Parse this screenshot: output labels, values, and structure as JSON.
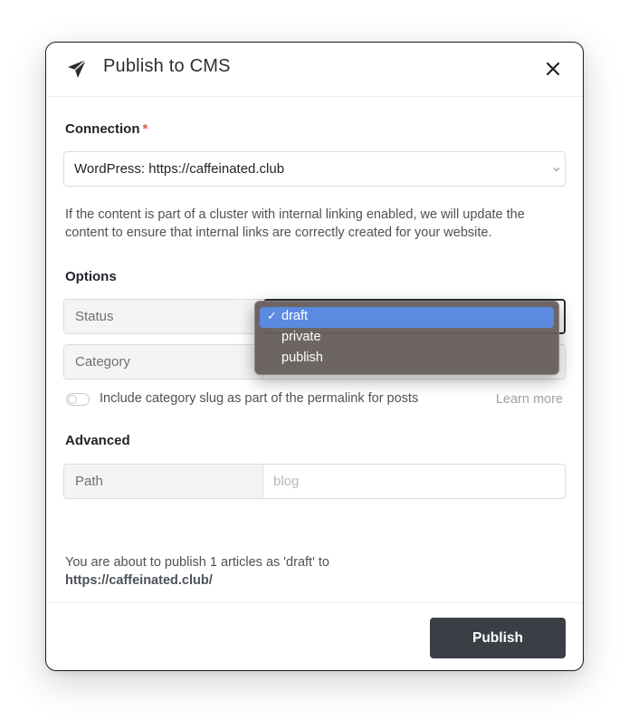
{
  "dialog": {
    "title": "Publish to CMS",
    "icon": "paper-plane-icon",
    "close_icon": "close-icon"
  },
  "connection": {
    "label": "Connection",
    "required_mark": "*",
    "selected": "WordPress: https://caffeinated.club",
    "help_text": "If the content is part of a cluster with internal linking enabled, we will update the content to ensure that internal links are correctly created for your website."
  },
  "options": {
    "label": "Options",
    "status": {
      "label": "Status",
      "options": [
        "draft",
        "private",
        "publish"
      ],
      "selected": "draft",
      "check_mark": "✓"
    },
    "category": {
      "label": "Category"
    },
    "toggle_label": "Include category slug as part of the permalink for posts",
    "toggle_on": false,
    "learn_more": "Learn more"
  },
  "advanced": {
    "label": "Advanced",
    "path": {
      "label": "Path",
      "placeholder": "blog"
    }
  },
  "summary": {
    "text": "You are about to publish 1 articles as 'draft' to",
    "url": "https://caffeinated.club/"
  },
  "footer": {
    "publish_label": "Publish"
  },
  "colors": {
    "primary_button": "#3a3f46",
    "selected_option": "#5b8be0",
    "required": "#e25b4b",
    "dropdown_bg": "#68605e"
  }
}
